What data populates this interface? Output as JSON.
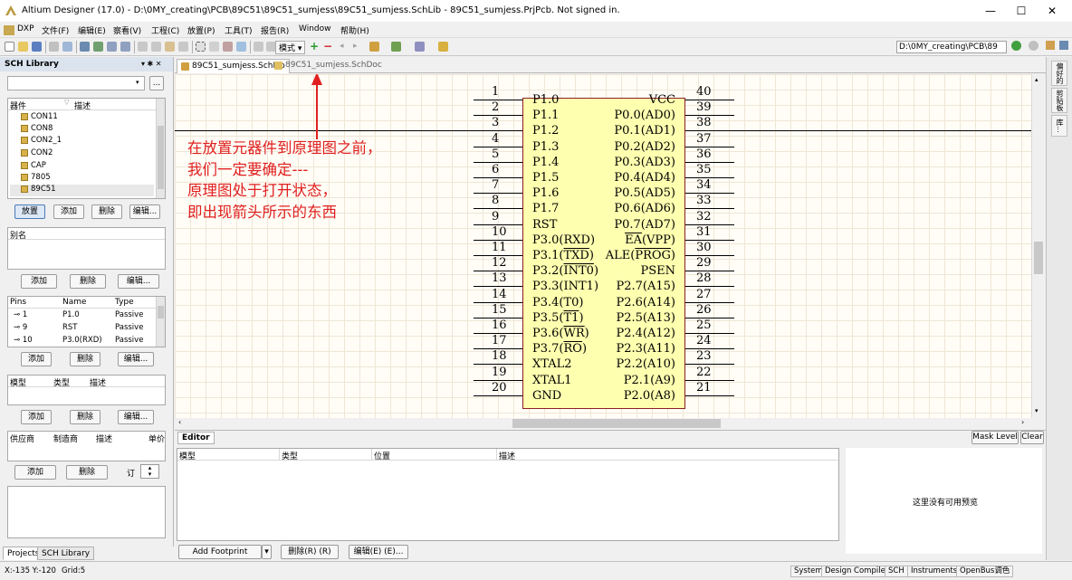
{
  "window": {
    "title": "Altium Designer (17.0) - D:\\0MY_creating\\PCB\\89C51\\89C51_sumjess\\89C51_sumjess.SchLib - 89C51_sumjess.PrjPcb. Not signed in.",
    "minimize": "—",
    "maximize": "☐",
    "close": "✕"
  },
  "menu": [
    "DXP",
    "文件(F)",
    "编辑(E)",
    "察看(V)",
    "工程(C)",
    "放置(P)",
    "工具(T)",
    "报告(R)",
    "Window",
    "帮助(H)"
  ],
  "toolbar": {
    "mode_label": "模式 ▾",
    "path": "D:\\0MY_creating\\PCB\\89"
  },
  "sch_library": {
    "title": "SCH Library",
    "search_value": "",
    "search_button": "...",
    "components_header": {
      "col1": "器件",
      "col2": "描述"
    },
    "components": [
      "CON11",
      "CON8",
      "CON2_1",
      "CON2",
      "CAP",
      "7805",
      "89C51"
    ],
    "comp_buttons": {
      "place": "放置",
      "add": "添加",
      "delete": "删除",
      "edit": "编辑..."
    },
    "alias_header": "别名",
    "alias_buttons": {
      "add": "添加",
      "delete": "删除",
      "edit": "编辑..."
    },
    "pins_header": {
      "pins": "Pins",
      "name": "Name",
      "type": "Type"
    },
    "pins": [
      {
        "num": "1",
        "name": "P1.0",
        "type": "Passive"
      },
      {
        "num": "9",
        "name": "RST",
        "type": "Passive"
      },
      {
        "num": "10",
        "name": "P3.0(RXD)",
        "type": "Passive"
      }
    ],
    "pin_buttons": {
      "add": "添加",
      "delete": "删除",
      "edit": "编辑..."
    },
    "model_header": {
      "model": "模型",
      "type": "类型",
      "desc": "描述"
    },
    "model_buttons": {
      "add": "添加",
      "delete": "删除",
      "edit": "编辑..."
    },
    "supplier_header": {
      "supplier": "供应商",
      "manufacturer": "制造商",
      "desc": "描述",
      "price": "单价"
    },
    "supplier_buttons": {
      "add": "添加",
      "delete": "删除",
      "order": "订"
    },
    "bottom_tabs": [
      "Projects",
      "SCH Library"
    ]
  },
  "doc_tabs": [
    {
      "label": "89C51_sumjess.SchLib",
      "active": true
    },
    {
      "label": "89C51_sumjess.SchDoc",
      "active": false
    }
  ],
  "chip": {
    "left_pins": [
      {
        "num": "1",
        "name": "P1.0"
      },
      {
        "num": "2",
        "name": "P1.1"
      },
      {
        "num": "3",
        "name": "P1.2"
      },
      {
        "num": "4",
        "name": "P1.3"
      },
      {
        "num": "5",
        "name": "P1.4"
      },
      {
        "num": "6",
        "name": "P1.5"
      },
      {
        "num": "7",
        "name": "P1.6"
      },
      {
        "num": "8",
        "name": "P1.7"
      },
      {
        "num": "9",
        "name": "RST"
      },
      {
        "num": "10",
        "name": "P3.0(RXD)"
      },
      {
        "num": "11",
        "name": "P3.1(TXD)"
      },
      {
        "num": "12",
        "name": "P3.2(INT0)"
      },
      {
        "num": "13",
        "name": "P3.3(INT1)"
      },
      {
        "num": "14",
        "name": "P3.4(T0)"
      },
      {
        "num": "15",
        "name": "P3.5(T1)"
      },
      {
        "num": "16",
        "name": "P3.6(WR)"
      },
      {
        "num": "17",
        "name": "P3.7(RO)"
      },
      {
        "num": "18",
        "name": "XTAL2"
      },
      {
        "num": "19",
        "name": "XTAL1"
      },
      {
        "num": "20",
        "name": "GND"
      }
    ],
    "right_pins": [
      {
        "num": "40",
        "name": "VCC"
      },
      {
        "num": "39",
        "name": "P0.0(AD0)"
      },
      {
        "num": "38",
        "name": "P0.1(AD1)"
      },
      {
        "num": "37",
        "name": "P0.2(AD2)"
      },
      {
        "num": "36",
        "name": "P0.3(AD3)"
      },
      {
        "num": "35",
        "name": "P0.4(AD4)"
      },
      {
        "num": "34",
        "name": "P0.5(AD5)"
      },
      {
        "num": "33",
        "name": "P0.6(AD6)"
      },
      {
        "num": "32",
        "name": "P0.7(AD7)"
      },
      {
        "num": "31",
        "name": "EA(VPP)"
      },
      {
        "num": "30",
        "name": "ALE(PROG)"
      },
      {
        "num": "29",
        "name": "PSEN"
      },
      {
        "num": "28",
        "name": "P2.7(A15)"
      },
      {
        "num": "27",
        "name": "P2.6(A14)"
      },
      {
        "num": "26",
        "name": "P2.5(A13)"
      },
      {
        "num": "25",
        "name": "P2.4(A12)"
      },
      {
        "num": "24",
        "name": "P2.3(A11)"
      },
      {
        "num": "23",
        "name": "P2.2(A10)"
      },
      {
        "num": "22",
        "name": "P2.1(A9)"
      },
      {
        "num": "21",
        "name": "P2.0(A8)"
      }
    ]
  },
  "annotation": {
    "lines": [
      "在放置元器件到原理图之前，",
      "我们一定要确定---",
      "原理图处于打开状态，",
      "即出现箭头所示的东西"
    ],
    "color": "#e02020"
  },
  "editor": {
    "tab": "Editor",
    "mask_level": "Mask Level",
    "clear": "Clear",
    "columns": [
      "模型",
      "类型",
      "位置",
      "描述"
    ],
    "preview_text": "这里没有可用预览",
    "add_footprint": "Add Footprint",
    "delete_button": "删除(R) (R)",
    "edit_button": "编辑(E) (E)..."
  },
  "right_sidebar": [
    "偏好的",
    "剪贴板",
    "库..."
  ],
  "status": {
    "coords": "X:-135 Y:-120",
    "grid": "Grid:5",
    "buttons": [
      "System",
      "Design Compiler",
      "SCH",
      "Instruments",
      "OpenBus调色"
    ]
  }
}
